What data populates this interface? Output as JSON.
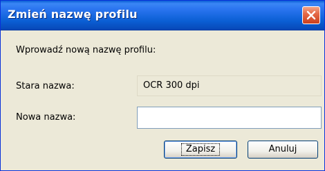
{
  "window": {
    "title": "Zmień nazwę profilu",
    "colors": {
      "titlebar": "#0a5fd4",
      "dialog_bg": "#ece9d8",
      "close_red": "#e56a48"
    }
  },
  "content": {
    "instruction": "Wprowadź nową nazwę profilu:",
    "old_name_label": "Stara nazwa:",
    "old_name_value": "OCR 300 dpi",
    "new_name_label": "Nowa nazwa:",
    "new_name_value": ""
  },
  "buttons": {
    "save": "Zapisz",
    "cancel": "Anuluj"
  },
  "icons": {
    "close": "close-icon"
  }
}
